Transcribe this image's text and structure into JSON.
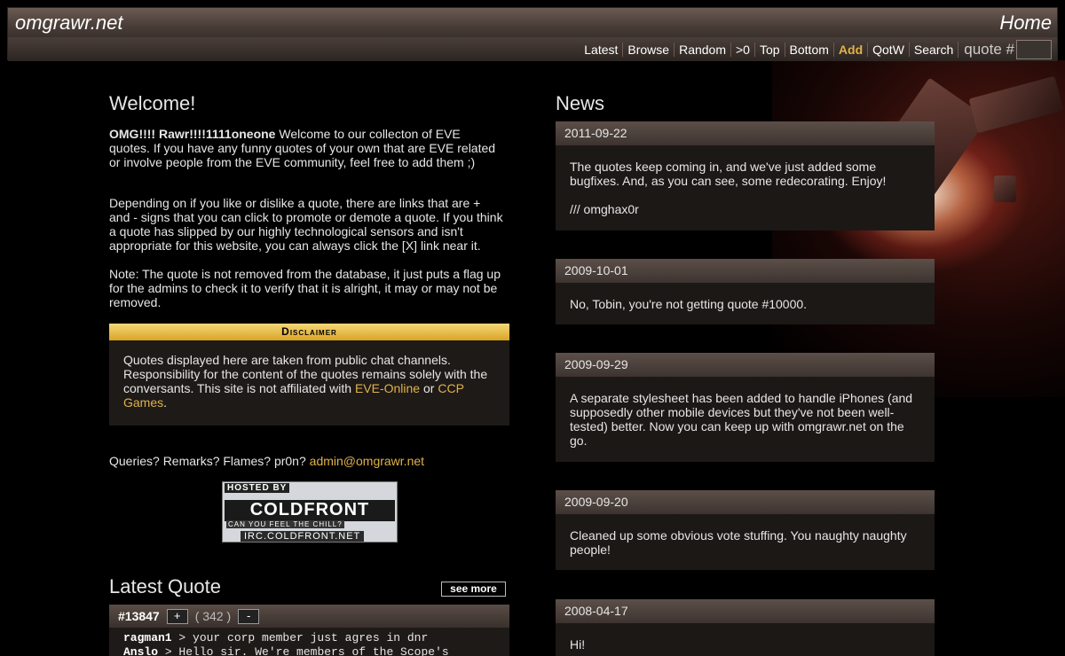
{
  "header": {
    "site_title": "omgrawr.net",
    "home_label": "Home",
    "nav": [
      "Latest",
      "Browse",
      "Random",
      ">0",
      "Top",
      "Bottom",
      "Add",
      "QotW",
      "Search"
    ],
    "active_nav": "Add",
    "quote_label": "quote #"
  },
  "welcome": {
    "title": "Welcome!",
    "p1_bold": "OMG!!!! Rawr!!!!1111oneone",
    "p1_text": " Welcome to our collecton of EVE quotes. If you have any funny quotes of your own that are EVE related or involve people from the EVE community, feel free to add them ;)",
    "p2": "Depending on if you like or dislike a quote, there are links that are + and - signs that you can click to promote or demote a quote. If you think a quote has slipped by our highly technological sensors and isn't appropriate for this website, you can always click the [X] link near it.",
    "p3": "Note: The quote is not removed from the database, it just puts a flag up for the admins to check it to verify that it is alright, it may or may not be removed."
  },
  "disclaimer": {
    "title": "Disclaimer",
    "text_a": "Quotes displayed here are taken from public chat channels. Responsibility for the content of the quotes remains solely with the conversants. This site is not affiliated with ",
    "link1": "EVE-Online",
    "text_b": " or ",
    "link2": "CCP Games",
    "text_c": "."
  },
  "contact": {
    "text": "Queries? Remarks? Flames? pr0n? ",
    "email": "admin@omgrawr.net"
  },
  "banner": {
    "top": "HOSTED BY",
    "main": "COLDFRONT",
    "sub": "CAN YOU FEEL THE CHILL?",
    "irc": "IRC.COLDFRONT.NET"
  },
  "latest_quote": {
    "title": "Latest Quote",
    "see_more": "see more",
    "id": "#13847",
    "plus": "+",
    "score": "( 342 )",
    "minus": "-",
    "lines": [
      {
        "nick": "ragman1",
        "text": " > your corp member just agres in dnr"
      },
      {
        "nick": "Anslo",
        "text": " > Hello sir. We're members of the Scope's"
      }
    ]
  },
  "news": {
    "title": "News",
    "items": [
      {
        "date": "2011-09-22",
        "text": "The quotes keep coming in, and we've just added some bugfixes. And, as you can see, some redecorating. Enjoy!",
        "sign": "/// omghax0r"
      },
      {
        "date": "2009-10-01",
        "text": "No, Tobin, you're not getting quote #10000."
      },
      {
        "date": "2009-09-29",
        "text": "A separate stylesheet has been added to handle iPhones (and supposedly other mobile devices but they've not been well-tested) better. Now you can keep up with omgrawr.net on the go."
      },
      {
        "date": "2009-09-20",
        "text": "Cleaned up some obvious vote stuffing. You naughty naughty people!"
      },
      {
        "date": "2008-04-17",
        "text": "Hi!"
      }
    ]
  },
  "colors": {
    "accent": "#e0b24a",
    "panel": "#1e1a18",
    "header": "#4a3e39"
  }
}
